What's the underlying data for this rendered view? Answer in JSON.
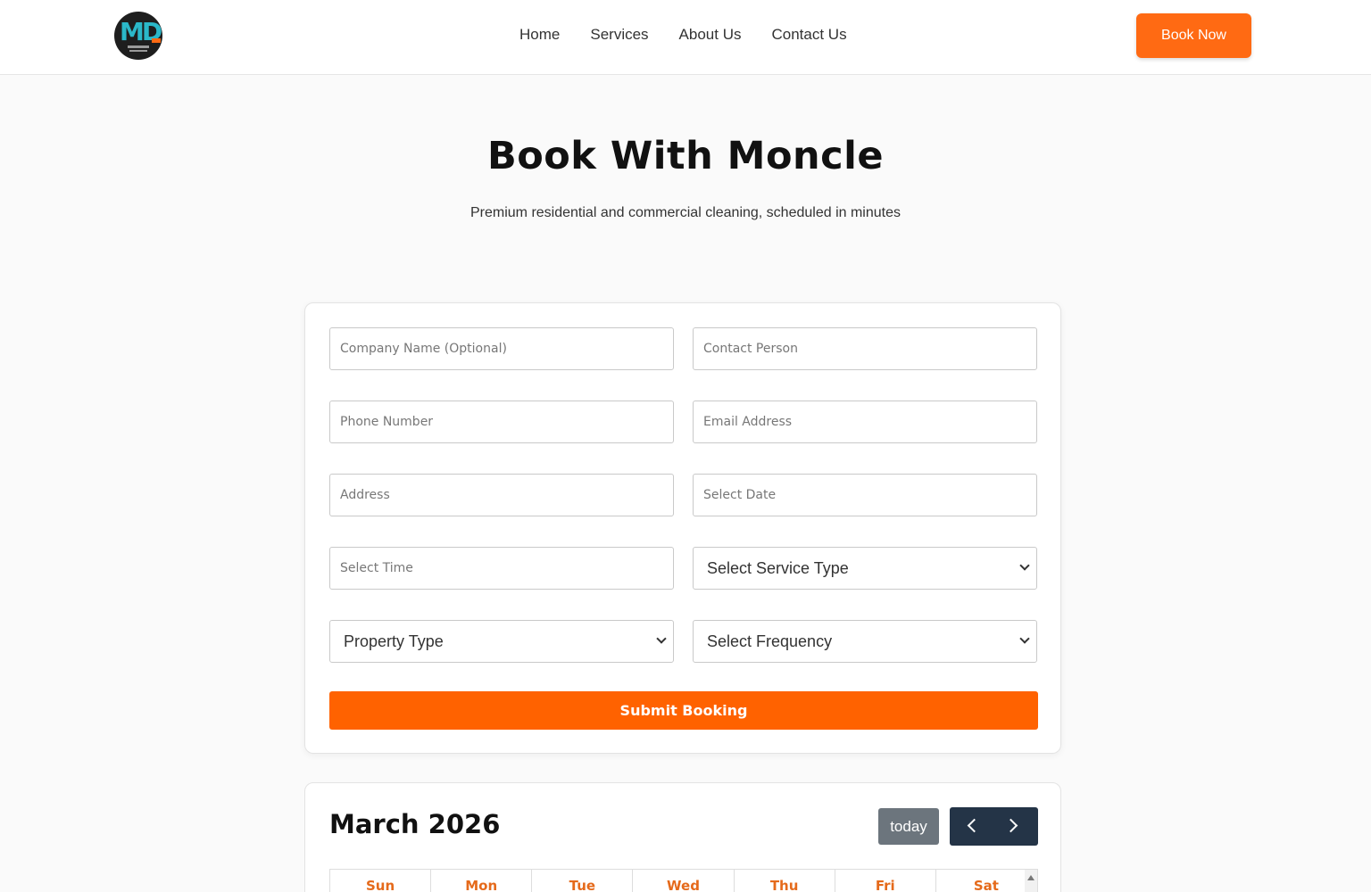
{
  "nav": {
    "links": [
      "Home",
      "Services",
      "About Us",
      "Contact Us"
    ],
    "book_label": "Book Now"
  },
  "hero": {
    "title": "Book With Moncle",
    "subtitle": "Premium residential and commercial cleaning, scheduled in minutes"
  },
  "form": {
    "company_placeholder": "Company Name (Optional)",
    "contact_placeholder": "Contact Person",
    "phone_placeholder": "Phone Number",
    "email_placeholder": "Email Address",
    "address_placeholder": "Address",
    "date_placeholder": "Select Date",
    "time_placeholder": "Select Time",
    "service_select": "Select Service Type",
    "property_select": "Property Type",
    "frequency_select": "Select Frequency",
    "submit_label": "Submit Booking"
  },
  "calendar": {
    "title": "March 2026",
    "today_label": "today",
    "weekdays": [
      "Sun",
      "Mon",
      "Tue",
      "Wed",
      "Thu",
      "Fri",
      "Sat"
    ]
  },
  "colors": {
    "accent": "#ff6a13",
    "submit": "#ff6200",
    "nav_buttons": "#243447",
    "today_button": "#6c757d",
    "weekday_text": "#e56a1b"
  }
}
